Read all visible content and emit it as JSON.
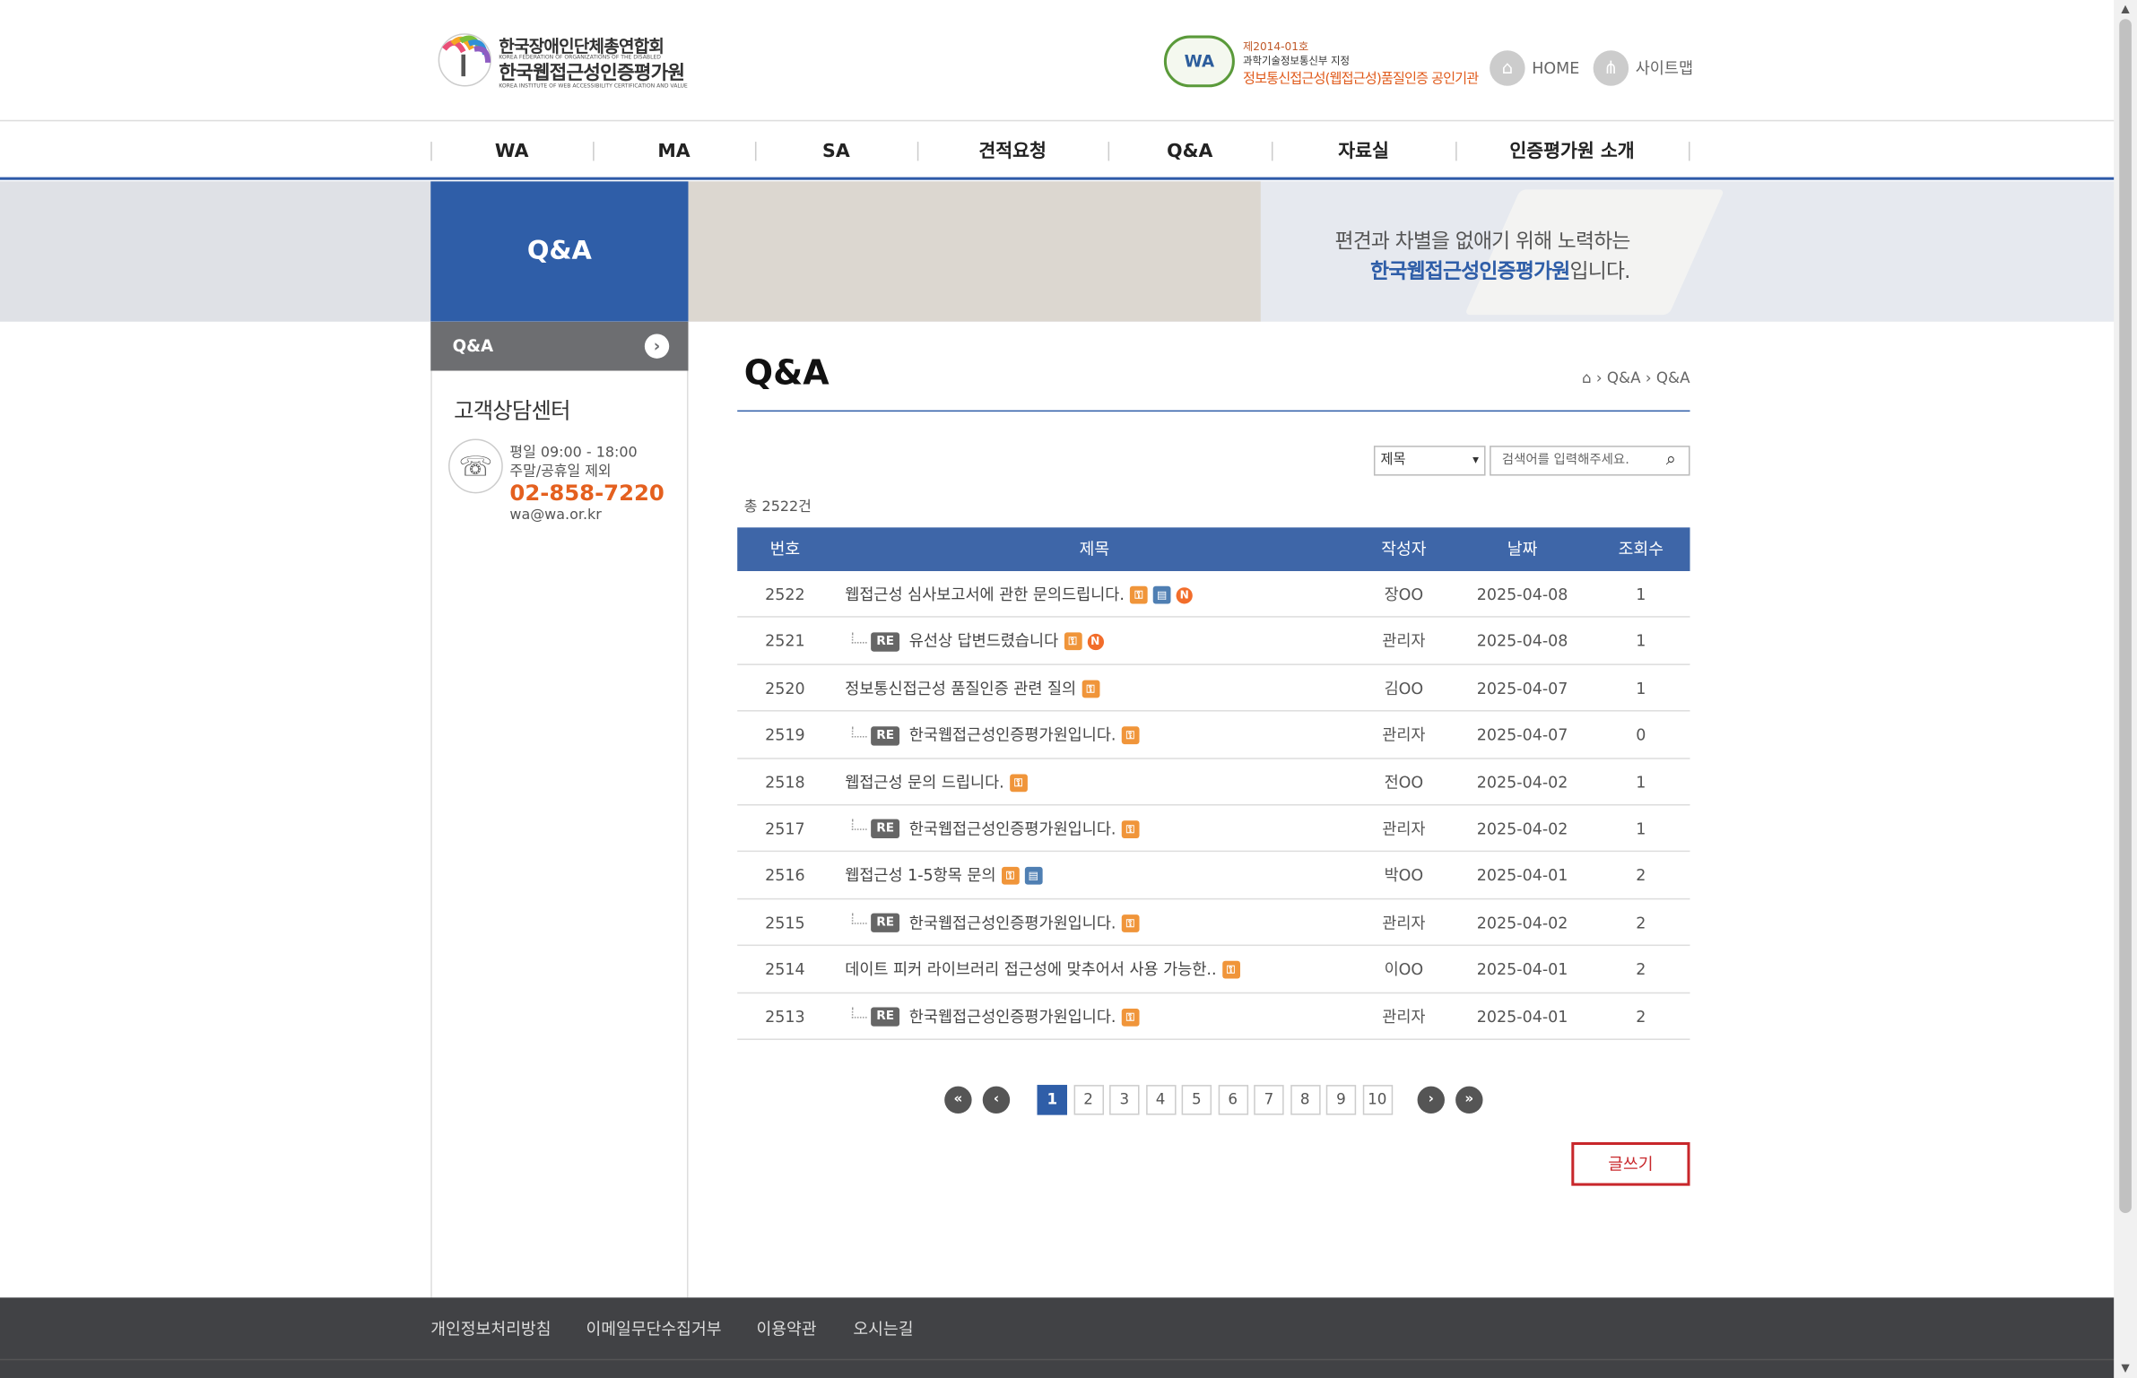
{
  "header": {
    "logo_org": "한국장애인단체총연합회",
    "logo_org_en": "KOREA FEDERATION OF ORGANIZATIONS OF THE DISABLED",
    "logo_name": "한국웹접근성인증평가원",
    "logo_name_en": "KOREA INSTITUTE OF WEB ACCESSIBILITY CERTIFICATION AND VALUE",
    "cert_badge": "WA",
    "cert_no": "제2014-01호",
    "cert_line1": "과학기술정보통신부 지정",
    "cert_line2": "정보통신접근성(웹접근성)품질인증 공인기관",
    "home_label": "HOME",
    "sitemap_label": "사이트맵"
  },
  "gnb": [
    "WA",
    "MA",
    "SA",
    "견적요청",
    "Q&A",
    "자료실",
    "인증평가원 소개"
  ],
  "visual": {
    "title": "Q&A",
    "slogan_line1": "편견과 차별을 없애기 위해 노력하는",
    "slogan_line2_bold": "한국웹접근성인증평가원",
    "slogan_line2_rest": "입니다."
  },
  "lnb": {
    "item": "Q&A",
    "cs_title": "고객상담센터",
    "cs_hours1": "평일 09:00 - 18:00",
    "cs_hours2": "주말/공휴일 제외",
    "cs_tel": "02-858-7220",
    "cs_mail": "wa@wa.or.kr"
  },
  "content": {
    "title": "Q&A",
    "breadcrumb_1": "Q&A",
    "breadcrumb_2": "Q&A",
    "search_select": "제목",
    "search_placeholder": "검색어를 입력해주세요.",
    "total": "총 2522건",
    "write_button": "글쓰기"
  },
  "board": {
    "headers": {
      "no": "번호",
      "title": "제목",
      "writer": "작성자",
      "date": "날짜",
      "views": "조회수"
    },
    "re_label": "RE",
    "rows": [
      {
        "no": "2522",
        "title": "웹접근성 심사보고서에 관한 문의드립니다.",
        "writer": "장OO",
        "date": "2025-04-08",
        "views": "1",
        "reply": false,
        "lock": true,
        "file": true,
        "new": true
      },
      {
        "no": "2521",
        "title": "유선상 답변드렸습니다",
        "writer": "관리자",
        "date": "2025-04-08",
        "views": "1",
        "reply": true,
        "lock": true,
        "file": false,
        "new": true
      },
      {
        "no": "2520",
        "title": "정보통신접근성 품질인증 관련 질의",
        "writer": "김OO",
        "date": "2025-04-07",
        "views": "1",
        "reply": false,
        "lock": true,
        "file": false,
        "new": false
      },
      {
        "no": "2519",
        "title": "한국웹접근성인증평가원입니다.",
        "writer": "관리자",
        "date": "2025-04-07",
        "views": "0",
        "reply": true,
        "lock": true,
        "file": false,
        "new": false
      },
      {
        "no": "2518",
        "title": "웹접근성 문의 드립니다.",
        "writer": "전OO",
        "date": "2025-04-02",
        "views": "1",
        "reply": false,
        "lock": true,
        "file": false,
        "new": false
      },
      {
        "no": "2517",
        "title": "한국웹접근성인증평가원입니다.",
        "writer": "관리자",
        "date": "2025-04-02",
        "views": "1",
        "reply": true,
        "lock": true,
        "file": false,
        "new": false
      },
      {
        "no": "2516",
        "title": "웹접근성 1-5항목 문의",
        "writer": "박OO",
        "date": "2025-04-01",
        "views": "2",
        "reply": false,
        "lock": true,
        "file": true,
        "new": false
      },
      {
        "no": "2515",
        "title": "한국웹접근성인증평가원입니다.",
        "writer": "관리자",
        "date": "2025-04-02",
        "views": "2",
        "reply": true,
        "lock": true,
        "file": false,
        "new": false
      },
      {
        "no": "2514",
        "title": "데이트 피커 라이브러리 접근성에 맞추어서 사용 가능한..",
        "writer": "이OO",
        "date": "2025-04-01",
        "views": "2",
        "reply": false,
        "lock": true,
        "file": false,
        "new": false
      },
      {
        "no": "2513",
        "title": "한국웹접근성인증평가원입니다.",
        "writer": "관리자",
        "date": "2025-04-01",
        "views": "2",
        "reply": true,
        "lock": true,
        "file": false,
        "new": false
      }
    ]
  },
  "pagination": {
    "pages": [
      "1",
      "2",
      "3",
      "4",
      "5",
      "6",
      "7",
      "8",
      "9",
      "10"
    ],
    "current": "1"
  },
  "footer": [
    "개인정보처리방침",
    "이메일무단수집거부",
    "이용약관",
    "오시는길"
  ]
}
